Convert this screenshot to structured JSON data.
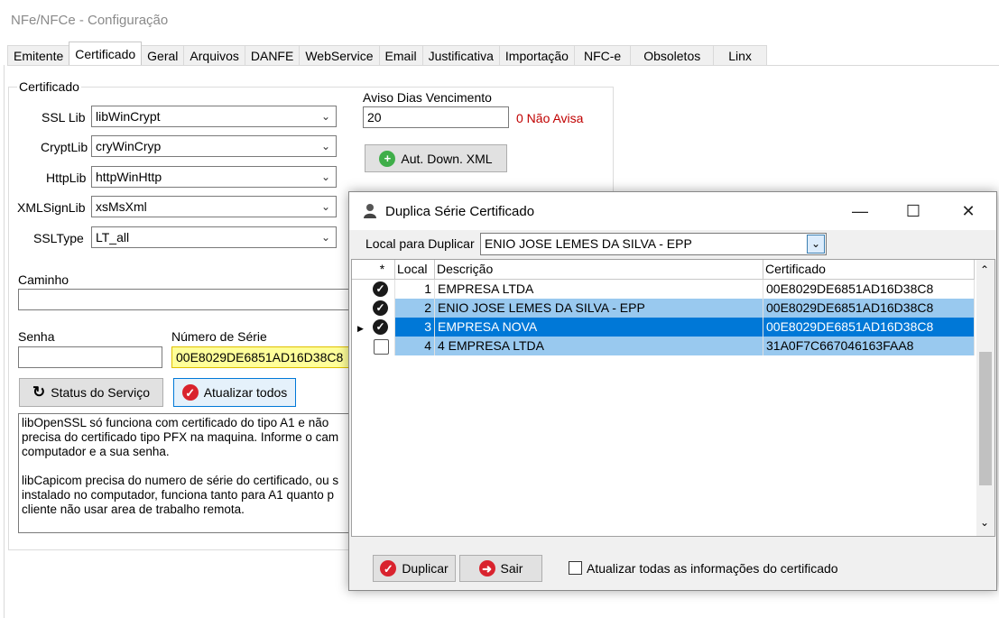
{
  "window_title": "NFe/NFCe - Configuração",
  "tabs": [
    "Emitente",
    "Certificado",
    "Geral",
    "Arquivos",
    "DANFE",
    "WebService",
    "Email",
    "Justificativa",
    "Importação",
    "NFC-e",
    "Obsoletos",
    "Linx"
  ],
  "active_tab": "Certificado",
  "certificado": {
    "group_label": "Certificado",
    "ssl_lib_label": "SSL Lib",
    "ssl_lib_value": "libWinCrypt",
    "crypt_lib_label": "CryptLib",
    "crypt_lib_value": "cryWinCryp",
    "http_lib_label": "HttpLib",
    "http_lib_value": "httpWinHttp",
    "xml_sign_lib_label": "XMLSignLib",
    "xml_sign_lib_value": "xsMsXml",
    "ssl_type_label": "SSLType",
    "ssl_type_value": "LT_all",
    "aviso_label": "Aviso Dias Vencimento",
    "aviso_value": "20",
    "aviso_hint": "0 Não Avisa",
    "aut_down_xml_button": "Aut. Down. XML",
    "caminho_label": "Caminho",
    "caminho_value": "",
    "senha_label": "Senha",
    "senha_value": "",
    "numero_serie_label": "Número de Série",
    "numero_serie_value": "00E8029DE6851AD16D38C8",
    "status_button": "Status do Serviço",
    "atualizar_todos_button": "Atualizar todos",
    "memo_text": "libOpenSSL só funciona com certificado do tipo A1 e não\nprecisa do certificado tipo PFX na maquina. Informe o cam\ncomputador e a sua senha.\n\nlibCapicom precisa do numero de série do certificado, ou s\ninstalado no computador, funciona tanto para A1 quanto p\ncliente não usar area de trabalho remota."
  },
  "dialog": {
    "title": "Duplica Série Certificado",
    "local_label": "Local para Duplicar",
    "local_value": "ENIO JOSE LEMES DA SILVA - EPP",
    "columns": [
      "*",
      "Local",
      "Descrição",
      "Certificado"
    ],
    "rows": [
      {
        "checked": true,
        "local": "1",
        "descricao": "EMPRESA LTDA",
        "certificado": "00E8029DE6851AD16D38C8",
        "state": "normal",
        "current": false
      },
      {
        "checked": true,
        "local": "2",
        "descricao": "ENIO JOSE LEMES DA SILVA - EPP",
        "certificado": "00E8029DE6851AD16D38C8",
        "state": "light",
        "current": false
      },
      {
        "checked": true,
        "local": "3",
        "descricao": "EMPRESA NOVA",
        "certificado": "00E8029DE6851AD16D38C8",
        "state": "selected",
        "current": true
      },
      {
        "checked": false,
        "local": "4",
        "descricao": "4 EMPRESA LTDA",
        "certificado": "31A0F7C667046163FAA8",
        "state": "light",
        "current": false
      }
    ],
    "duplicar_button": "Duplicar",
    "sair_button": "Sair",
    "atualizar_checkbox_label": "Atualizar todas as informações do certificado",
    "atualizar_checkbox_checked": false
  },
  "colors": {
    "selected_row": "#0078d7",
    "light_row": "#99c9ef",
    "highlight_input": "#ffff99",
    "red_icon": "#d9232e",
    "green_icon": "#3fae49",
    "hint_red": "#c00000"
  }
}
